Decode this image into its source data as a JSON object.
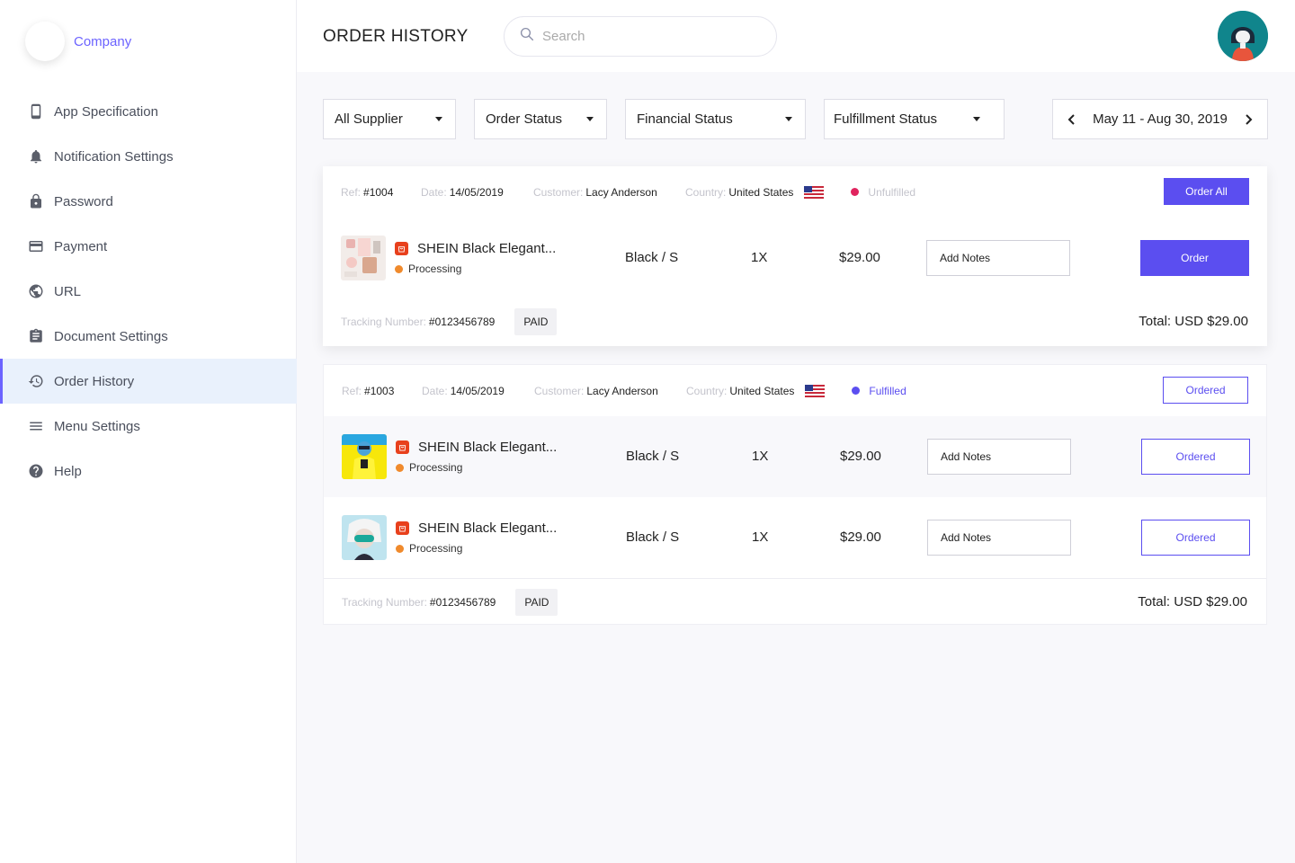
{
  "brand": {
    "name": "Company"
  },
  "sidebar": {
    "items": [
      {
        "label": "App Specification",
        "icon": "phone-icon"
      },
      {
        "label": "Notification Settings",
        "icon": "bell-icon"
      },
      {
        "label": "Password",
        "icon": "lock-icon"
      },
      {
        "label": "Payment",
        "icon": "credit-card-icon"
      },
      {
        "label": "URL",
        "icon": "globe-icon"
      },
      {
        "label": "Document Settings",
        "icon": "clipboard-icon"
      },
      {
        "label": "Order History",
        "icon": "history-icon",
        "active": true
      },
      {
        "label": "Menu Settings",
        "icon": "menu-icon"
      },
      {
        "label": "Help",
        "icon": "help-icon"
      }
    ]
  },
  "header": {
    "title": "ORDER HISTORY",
    "search_placeholder": "Search"
  },
  "filters": {
    "supplier": "All Supplier",
    "order_status": "Order Status",
    "financial_status": "Financial Status",
    "fulfillment_status": "Fulfillment Status",
    "date_range": "May 11 - Aug 30, 2019"
  },
  "labels": {
    "ref": "Ref:",
    "date": "Date:",
    "customer": "Customer:",
    "country": "Country:",
    "tracking": "Tracking Number:",
    "notes_placeholder": "Add Notes"
  },
  "colors": {
    "accent": "#5b4ef0",
    "unfulfilled": "#e0245e",
    "fulfilled": "#5b4ef0",
    "processing": "#f08a2c"
  },
  "orders": [
    {
      "ref": "#1004",
      "date": "14/05/2019",
      "customer": "Lacy Anderson",
      "country": "United States",
      "status": "Unfulfilled",
      "action": "Order All",
      "items": [
        {
          "name": "SHEIN Black Elegant...",
          "status": "Processing",
          "variant": "Black / S",
          "qty": "1X",
          "price": "$29.00",
          "action": "Order"
        }
      ],
      "tracking": "#0123456789",
      "payment": "PAID",
      "total": "Total: USD $29.00"
    },
    {
      "ref": "#1003",
      "date": "14/05/2019",
      "customer": "Lacy Anderson",
      "country": "United States",
      "status": "Fulfilled",
      "action": "Ordered",
      "items": [
        {
          "name": "SHEIN Black Elegant...",
          "status": "Processing",
          "variant": "Black / S",
          "qty": "1X",
          "price": "$29.00",
          "action": "Ordered"
        },
        {
          "name": "SHEIN Black Elegant...",
          "status": "Processing",
          "variant": "Black / S",
          "qty": "1X",
          "price": "$29.00",
          "action": "Ordered"
        }
      ],
      "tracking": "#0123456789",
      "payment": "PAID",
      "total": "Total: USD $29.00"
    }
  ]
}
